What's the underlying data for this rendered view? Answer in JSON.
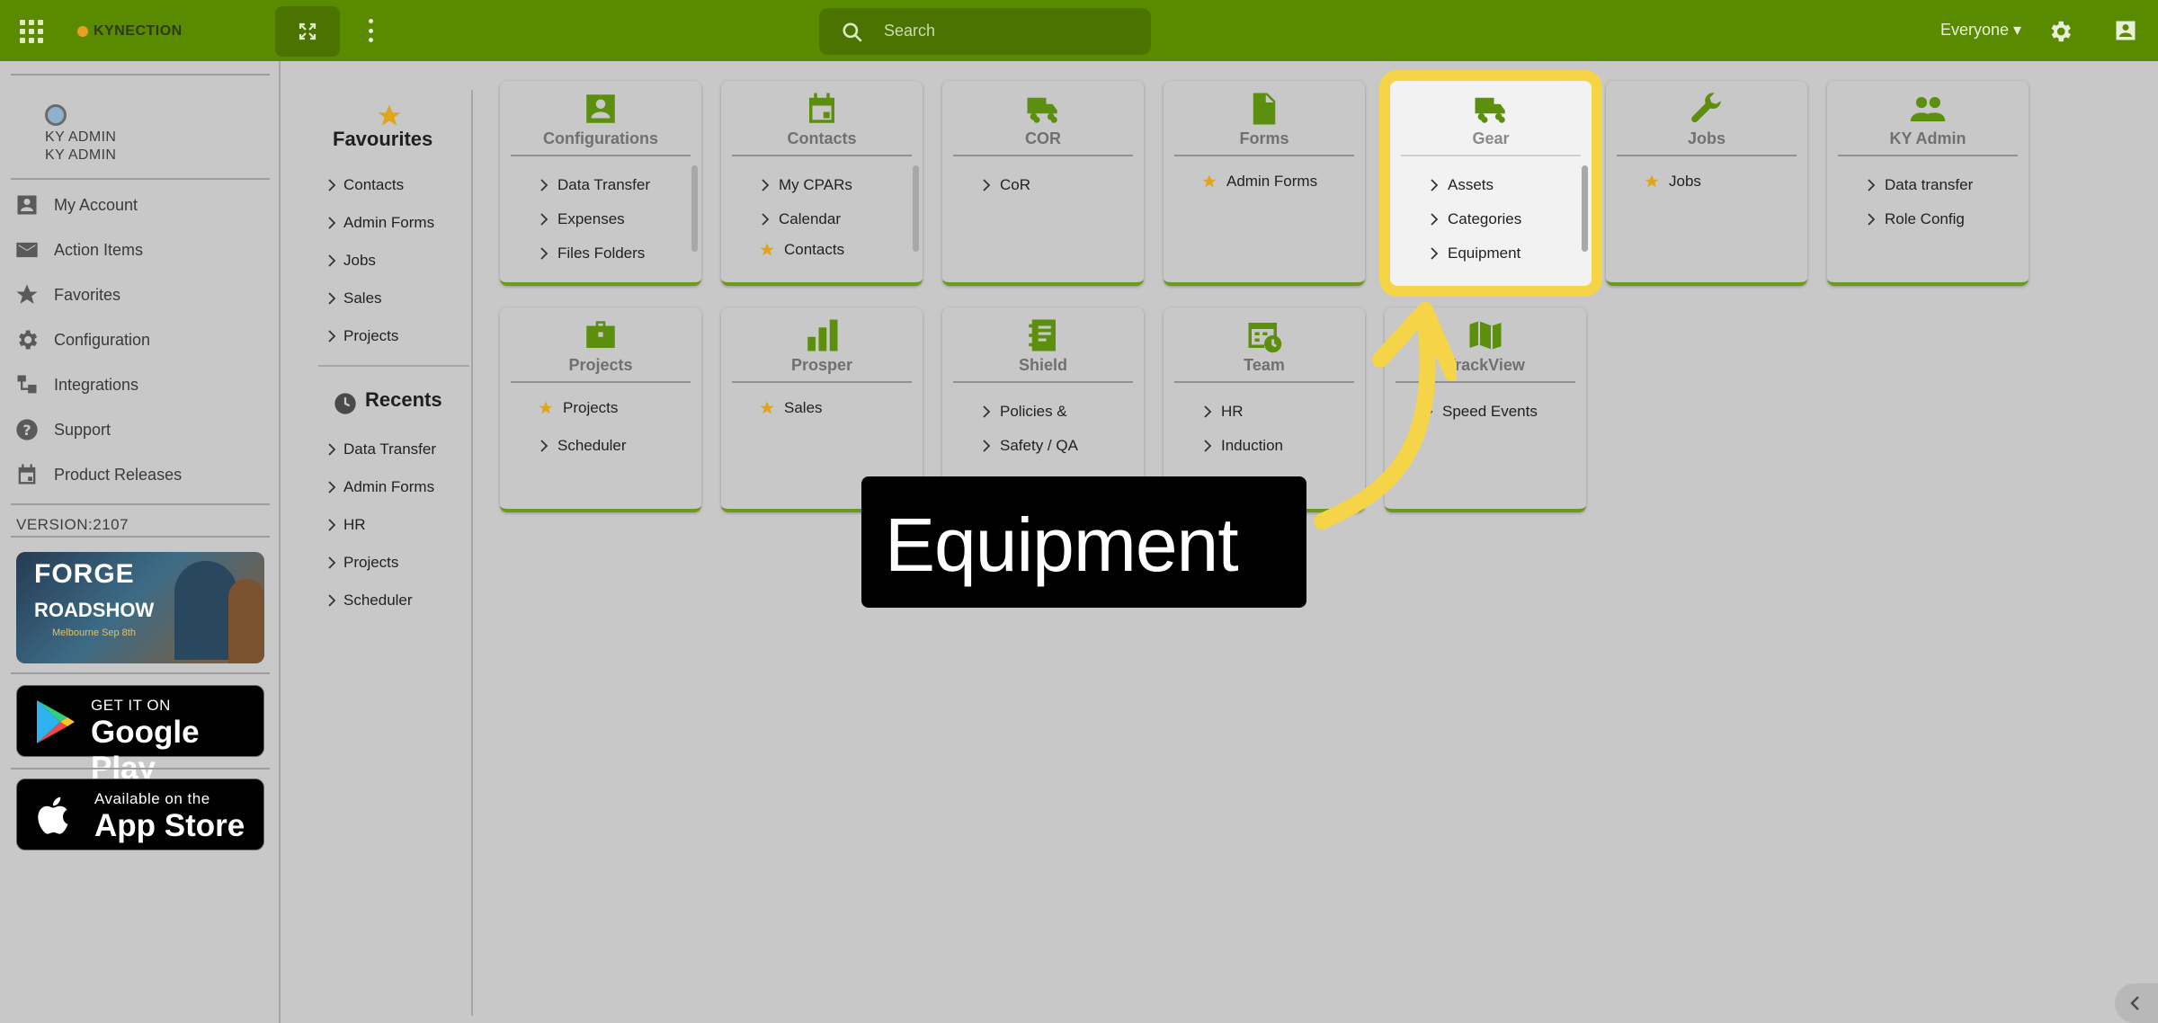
{
  "topbar": {
    "logo_text": "KYNECTION",
    "search_placeholder": "Search",
    "scope_selector": "Everyone"
  },
  "sidebar": {
    "user_name": "KY ADMIN",
    "user_role": "KY ADMIN",
    "items": [
      {
        "label": "My Account",
        "icon": "account-box-icon"
      },
      {
        "label": "Action Items",
        "icon": "mail-icon"
      },
      {
        "label": "Favorites",
        "icon": "star-icon"
      },
      {
        "label": "Configuration",
        "icon": "gear-icon"
      },
      {
        "label": "Integrations",
        "icon": "integration-icon"
      },
      {
        "label": "Support",
        "icon": "help-icon"
      },
      {
        "label": "Product Releases",
        "icon": "calendar-icon"
      }
    ],
    "version": "VERSION:2107",
    "promo": {
      "line1": "FORGE",
      "line2": "ROADSHOW",
      "line3": "Melbourne Sep 8th"
    },
    "google_play": {
      "small": "GET IT ON",
      "big": "Google Play"
    },
    "app_store": {
      "small": "Available on the",
      "big": "App Store"
    }
  },
  "favourites": {
    "title": "Favourites",
    "items": [
      "Contacts",
      "Admin Forms",
      "Jobs",
      "Sales",
      "Projects"
    ]
  },
  "recents": {
    "title": "Recents",
    "items": [
      "Data Transfer",
      "Admin Forms",
      "HR",
      "Projects",
      "Scheduler"
    ]
  },
  "tiles": [
    {
      "title": "Configurations",
      "icon": "contact-card-icon",
      "items": [
        {
          "label": "Data Transfer",
          "fav": false
        },
        {
          "label": "Expenses",
          "fav": false
        },
        {
          "label": "Files Folders",
          "fav": false
        }
      ]
    },
    {
      "title": "Contacts",
      "icon": "calendar-icon",
      "items": [
        {
          "label": "My CPARs",
          "fav": false
        },
        {
          "label": "Calendar",
          "fav": false
        },
        {
          "label": "Contacts",
          "fav": true
        }
      ]
    },
    {
      "title": "COR",
      "icon": "truck-icon",
      "items": [
        {
          "label": "CoR",
          "fav": false
        }
      ]
    },
    {
      "title": "Forms",
      "icon": "document-icon",
      "items": [
        {
          "label": "Admin Forms",
          "fav": true
        }
      ]
    },
    {
      "title": "Gear",
      "icon": "truck-icon",
      "items": [
        {
          "label": "Assets",
          "fav": false
        },
        {
          "label": "Categories",
          "fav": false
        },
        {
          "label": "Equipment",
          "fav": false
        }
      ]
    },
    {
      "title": "Jobs",
      "icon": "wrench-icon",
      "items": [
        {
          "label": "Jobs",
          "fav": true
        }
      ]
    },
    {
      "title": "KY Admin",
      "icon": "people-icon",
      "items": [
        {
          "label": "Data transfer",
          "fav": false
        },
        {
          "label": "Role Config",
          "fav": false
        }
      ]
    },
    {
      "title": "Projects",
      "icon": "briefcase-icon",
      "items": [
        {
          "label": "Projects",
          "fav": true
        },
        {
          "label": "Scheduler",
          "fav": false
        }
      ]
    },
    {
      "title": "Prosper",
      "icon": "bar-chart-icon",
      "items": [
        {
          "label": "Sales",
          "fav": true
        }
      ]
    },
    {
      "title": "Shield",
      "icon": "notebook-icon",
      "items": [
        {
          "label": "Policies &",
          "fav": false
        },
        {
          "label": "Safety / QA",
          "fav": false
        }
      ]
    },
    {
      "title": "Team",
      "icon": "schedule-icon",
      "items": [
        {
          "label": "HR",
          "fav": false
        },
        {
          "label": "Induction",
          "fav": false
        }
      ]
    },
    {
      "title": "TrackView",
      "icon": "map-icon",
      "items": [
        {
          "label": "Speed Events",
          "fav": false
        }
      ]
    }
  ],
  "highlight": {
    "tile": "Gear",
    "color": "#f5d547"
  },
  "callout": {
    "text": "Equipment"
  },
  "colors": {
    "brand": "#5a8a00",
    "accent": "#6d9a1d",
    "star": "#e0a51c"
  }
}
